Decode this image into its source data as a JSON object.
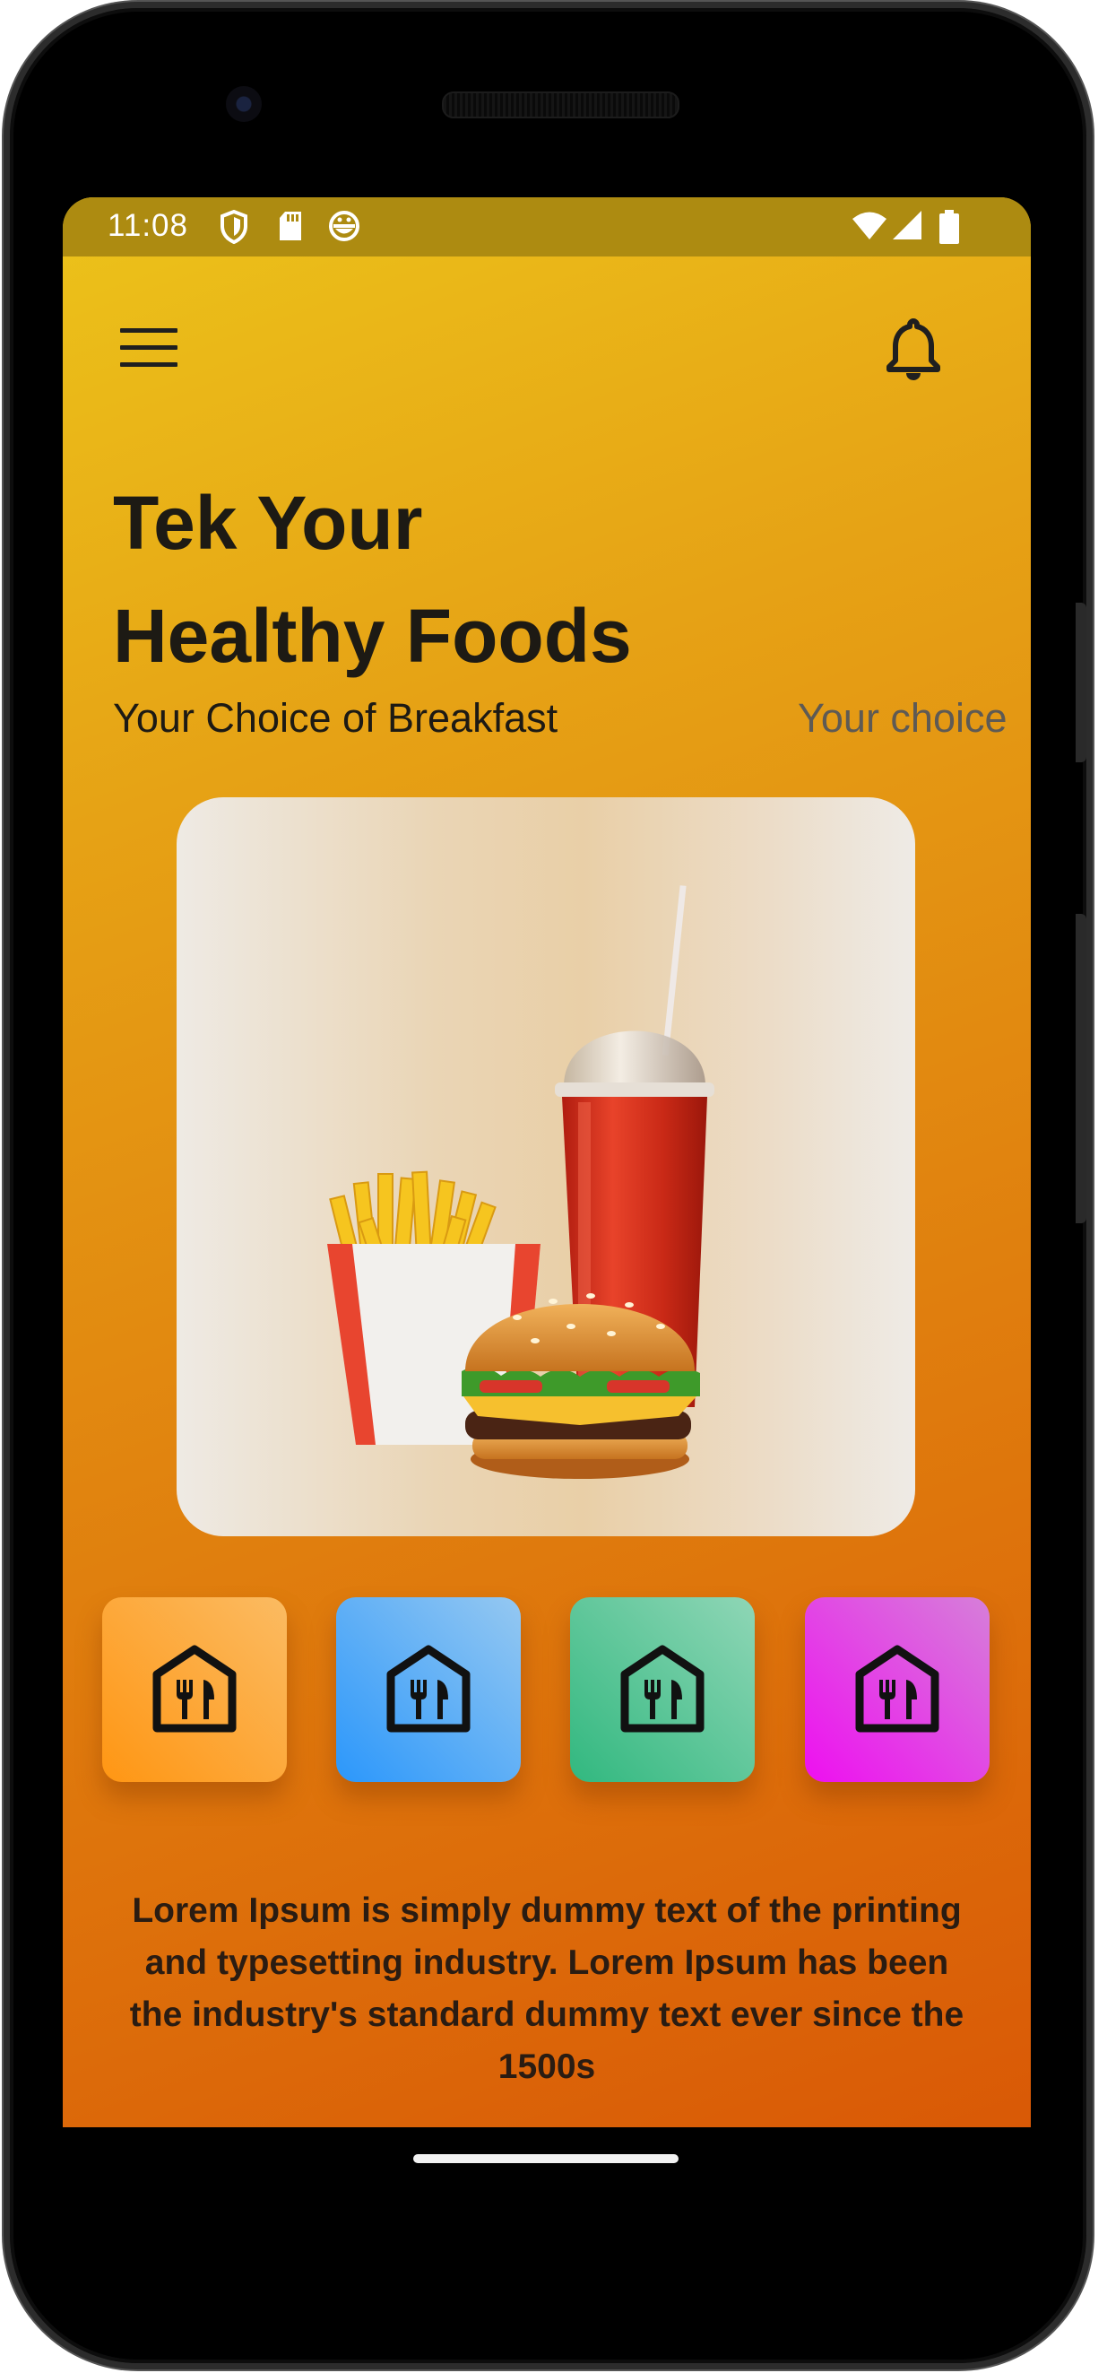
{
  "status_bar": {
    "time": "11:08",
    "left_icons": [
      "shield-icon",
      "sd-card-icon",
      "android-debug-icon"
    ],
    "right_icons": [
      "wifi-icon",
      "cellular-signal-icon",
      "battery-icon"
    ]
  },
  "app_bar": {
    "menu_icon": "menu-icon",
    "notification_icon": "bell-icon"
  },
  "hero": {
    "title_line1": "Tek Your",
    "title_line2": "Healthy Foods",
    "subtitle_active": "Your Choice of Breakfast",
    "subtitle_next": "Your choice"
  },
  "food_card": {
    "image": "burger-fries-drink-illustration"
  },
  "categories": [
    {
      "icon": "restaurant-house-icon",
      "color_start": "#ff9613",
      "color_end": "#fbbb62"
    },
    {
      "icon": "restaurant-house-icon",
      "color_start": "#2b97fb",
      "color_end": "#95c8f1"
    },
    {
      "icon": "restaurant-house-icon",
      "color_start": "#31b87f",
      "color_end": "#8fd6b6"
    },
    {
      "icon": "restaurant-house-icon",
      "color_start": "#ee0ff0",
      "color_end": "#d67fd9"
    }
  ],
  "description": "Lorem Ipsum is simply dummy text of the printing and typesetting industry. Lorem Ipsum has been the industry's standard dummy text ever since the 1500s",
  "colors": {
    "background_top": "#ecc31a",
    "background_bottom": "#d95906",
    "status_bar": "#ad8b11",
    "text_dark": "#1d1a14"
  }
}
